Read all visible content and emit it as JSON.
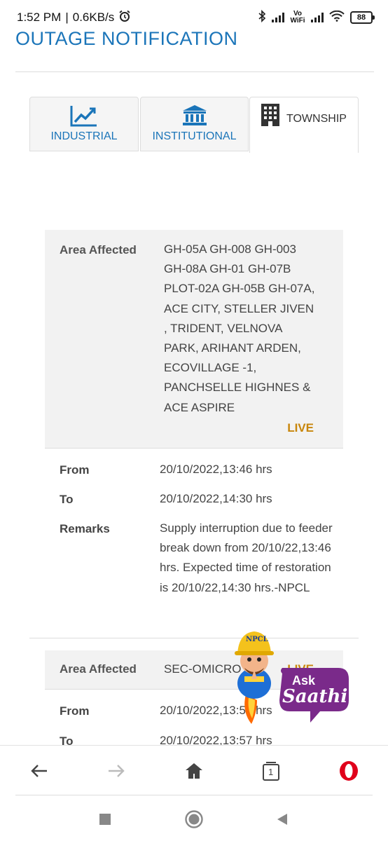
{
  "status_bar": {
    "time": "1:52 PM",
    "separator": "|",
    "speed": "0.6KB/s",
    "network_type": "Vo WiFi",
    "battery": "88"
  },
  "page": {
    "title": "OUTAGE NOTIFICATION"
  },
  "tabs": [
    {
      "label": "INDUSTRIAL",
      "icon": "chart-line-icon",
      "selected": false
    },
    {
      "label": "INSTITUTIONAL",
      "icon": "institution-icon",
      "selected": false
    },
    {
      "label": "TOWNSHIP",
      "icon": "building-icon",
      "selected": true
    }
  ],
  "outages": [
    {
      "area_label": "Area Affected",
      "area": "GH-05A GH-008 GH-003 GH-08A GH-01 GH-07B PLOT-02A GH-05B GH-07A, ACE CITY, STELLER JIVEN , TRIDENT, VELNOVA PARK, ARIHANT ARDEN, ECOVILLAGE -1, PANCHSELLE HIGHNES & ACE ASPIRE",
      "status": "LIVE",
      "from_label": "From",
      "from": "20/10/2022,13:46 hrs",
      "to_label": "To",
      "to": "20/10/2022,14:30 hrs",
      "remarks_label": "Remarks",
      "remarks": "Supply interruption due to feeder break down from 20/10/22,13:46 hrs. Expected time of restoration is 20/10/22,14:30 hrs.-NPCL"
    },
    {
      "area_label": "Area Affected",
      "area": "SEC-OMICRO",
      "status": "LIVE",
      "from_label": "From",
      "from": "20/10/2022,13:57 hrs",
      "to_label": "To",
      "to": "20/10/2022,13:57 hrs"
    }
  ],
  "assistant": {
    "helmet_text": "NPCL",
    "label_top": "Ask",
    "label_bottom": "Saathi"
  },
  "browser_nav": {
    "tab_count": "1",
    "back_icon": "back-arrow-icon",
    "forward_icon": "forward-arrow-icon",
    "home_icon": "home-icon",
    "tabs_icon": "tabs-icon",
    "menu_icon": "opera-icon"
  },
  "colors": {
    "accent": "#1b75b9",
    "live": "#c8860b",
    "opera_red": "#e0001b",
    "card_bg": "#f2f2f2"
  }
}
